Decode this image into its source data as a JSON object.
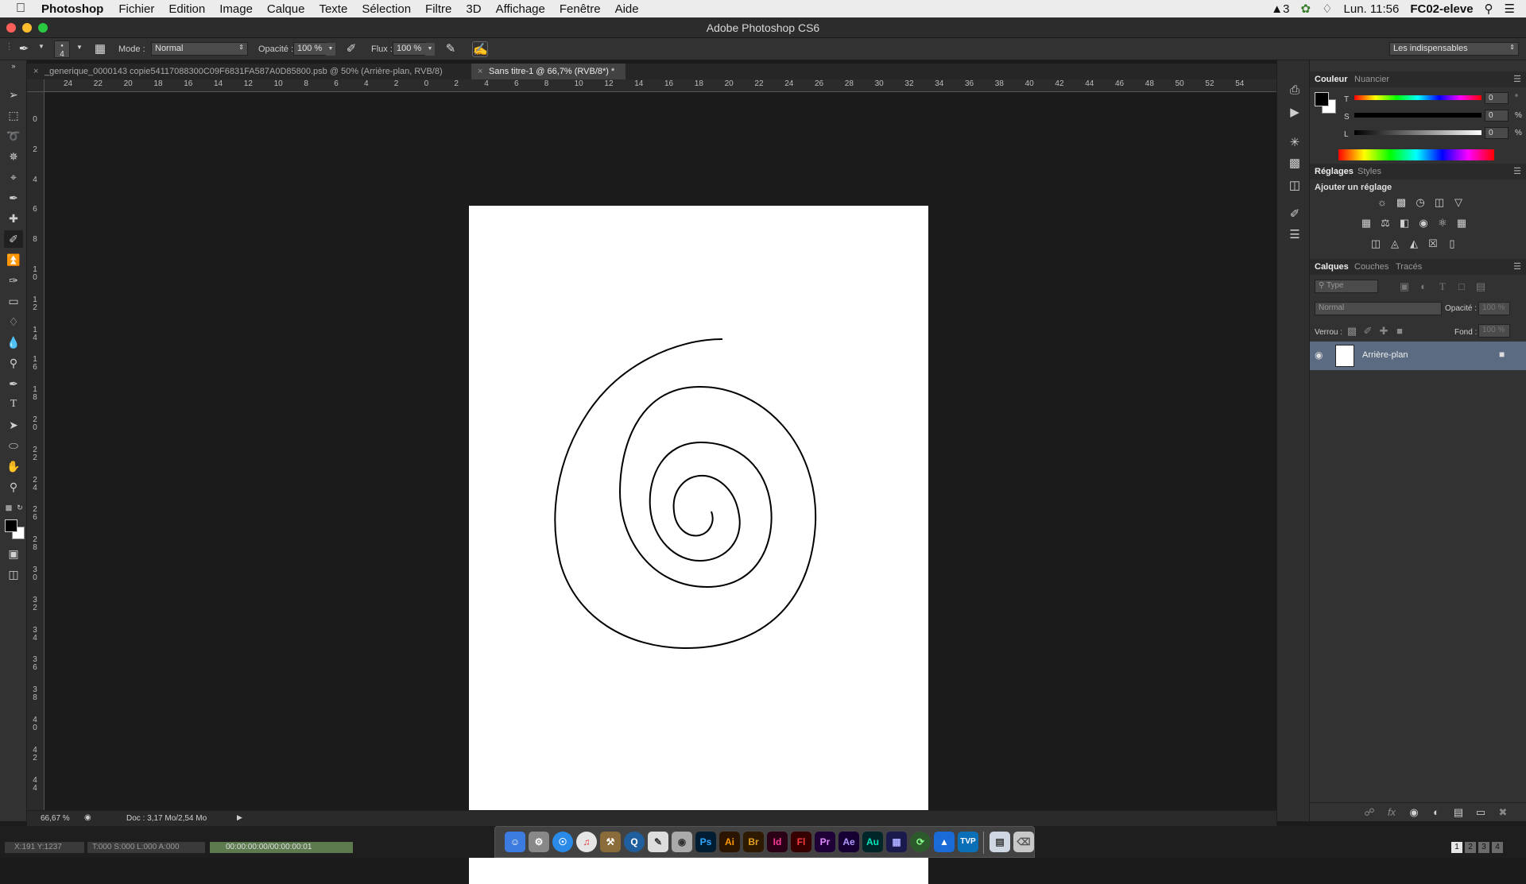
{
  "menubar": {
    "app": "Photoshop",
    "items": [
      "Fichier",
      "Edition",
      "Image",
      "Calque",
      "Texte",
      "Sélection",
      "Filtre",
      "3D",
      "Affichage",
      "Fenêtre",
      "Aide"
    ],
    "adobe_badge": "3",
    "clock": "Lun. 11:56",
    "user": "FC02-eleve"
  },
  "window": {
    "title": "Adobe Photoshop CS6"
  },
  "options": {
    "brush_size": "4",
    "mode_label": "Mode :",
    "mode_value": "Normal",
    "opacity_label": "Opacité :",
    "opacity_value": "100 %",
    "flux_label": "Flux :",
    "flux_value": "100 %",
    "workspace": "Les indispensables"
  },
  "tabs": [
    {
      "label": "_generique_0000143 copie54117088300C09F6831FA587A0D85800.psb @ 50% (Arrière-plan, RVB/8)"
    },
    {
      "label": "Sans titre-1 @ 66,7% (RVB/8*) *"
    }
  ],
  "ruler": {
    "top": [
      "24",
      "22",
      "20",
      "18",
      "16",
      "14",
      "12",
      "10",
      "8",
      "6",
      "4",
      "2",
      "0",
      "2",
      "4",
      "6",
      "8",
      "10",
      "12",
      "14",
      "16",
      "18",
      "20",
      "22",
      "24",
      "26",
      "28",
      "30",
      "32",
      "34",
      "36",
      "38",
      "40",
      "42",
      "44",
      "46",
      "48",
      "50",
      "52",
      "54"
    ],
    "left": [
      "0",
      "2",
      "4",
      "6",
      "8",
      "10",
      "12",
      "14",
      "16",
      "18",
      "20",
      "22",
      "24",
      "26",
      "28",
      "30",
      "32",
      "34",
      "36",
      "38",
      "40",
      "42",
      "44"
    ]
  },
  "status": {
    "zoom": "66,67 %",
    "doc": "Doc : 3,17 Mo/2,54 Mo",
    "coords": "X:191  Y:1237",
    "tsla": "T:000 S:000 L:000 A:000",
    "timecode": "00:00:00:00/00:00:00:01"
  },
  "panels": {
    "color": {
      "tabs": [
        "Couleur",
        "Nuancier"
      ],
      "sliders": [
        {
          "label": "T",
          "value": "0",
          "unit": "°"
        },
        {
          "label": "S",
          "value": "0",
          "unit": "%"
        },
        {
          "label": "L",
          "value": "0",
          "unit": "%"
        }
      ]
    },
    "adjust": {
      "tabs": [
        "Réglages",
        "Styles"
      ],
      "heading": "Ajouter un réglage"
    },
    "layers": {
      "tabs": [
        "Calques",
        "Couches",
        "Tracés"
      ],
      "filter_placeholder": "Type",
      "blend": "Normal",
      "opacity_label": "Opacité :",
      "opacity_value": "100 %",
      "lock_label": "Verrou :",
      "fill_label": "Fond :",
      "fill_value": "100 %",
      "layer_name": "Arrière-plan"
    }
  },
  "dock_apps": [
    "Ps",
    "Ai",
    "Br",
    "Id",
    "Fl",
    "Pr",
    "Ae",
    "Au",
    "TVP"
  ],
  "colors": {
    "ps_blue": "#001d34",
    "ai_orange": "#2b1500",
    "br_brown": "#2d1a00",
    "id_pink": "#2b0016",
    "fl_red": "#360000",
    "pr_purple": "#1f0037",
    "ae_violet": "#160033",
    "au_teal": "#00262a"
  }
}
